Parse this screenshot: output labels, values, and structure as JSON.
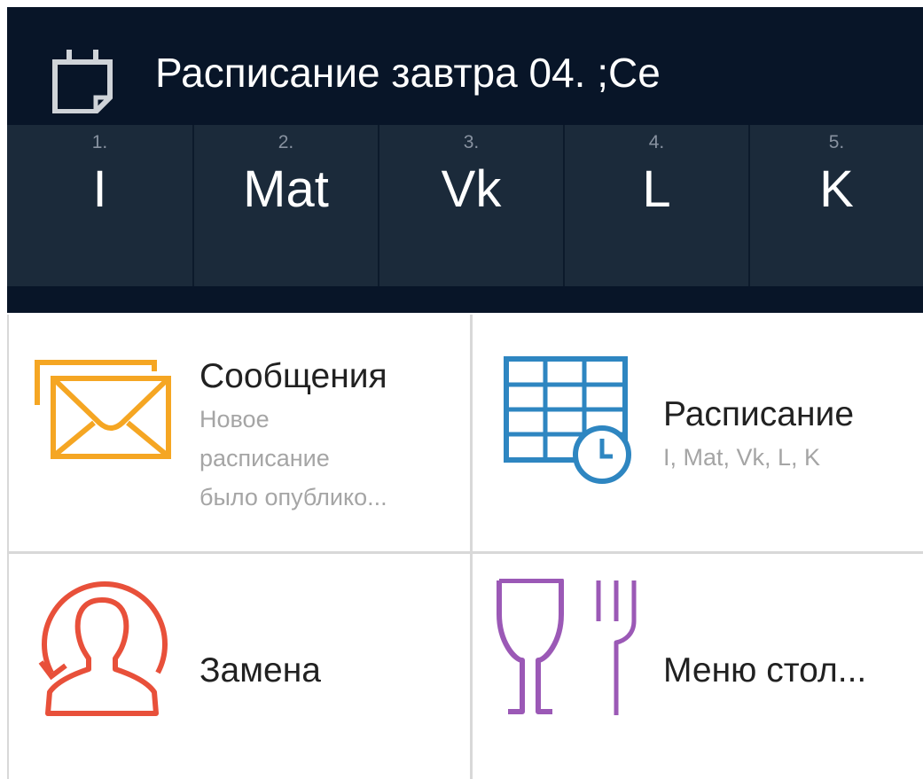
{
  "header": {
    "title": "Расписание завтра 04. ;Се"
  },
  "periods": [
    {
      "num": "1.",
      "subject": "I"
    },
    {
      "num": "2.",
      "subject": "Mat"
    },
    {
      "num": "3.",
      "subject": "Vk"
    },
    {
      "num": "4.",
      "subject": "L"
    },
    {
      "num": "5.",
      "subject": "K"
    }
  ],
  "tiles": {
    "messages": {
      "title": "Сообщения",
      "subtitle_line1": "Новое",
      "subtitle_line2": "расписание",
      "subtitle_line3": "было опублико...",
      "icon": "envelope-icon",
      "color": "#f5a623"
    },
    "schedule": {
      "title": "Расписание",
      "subtitle": "I, Mat, Vk, L, K",
      "icon": "timetable-clock-icon",
      "color": "#2e86c1"
    },
    "substitution": {
      "title": "Замена",
      "icon": "person-swap-icon",
      "color": "#e8503a"
    },
    "cafeteria": {
      "title": "Меню стол...",
      "icon": "glass-fork-icon",
      "color": "#9b59b6"
    }
  }
}
